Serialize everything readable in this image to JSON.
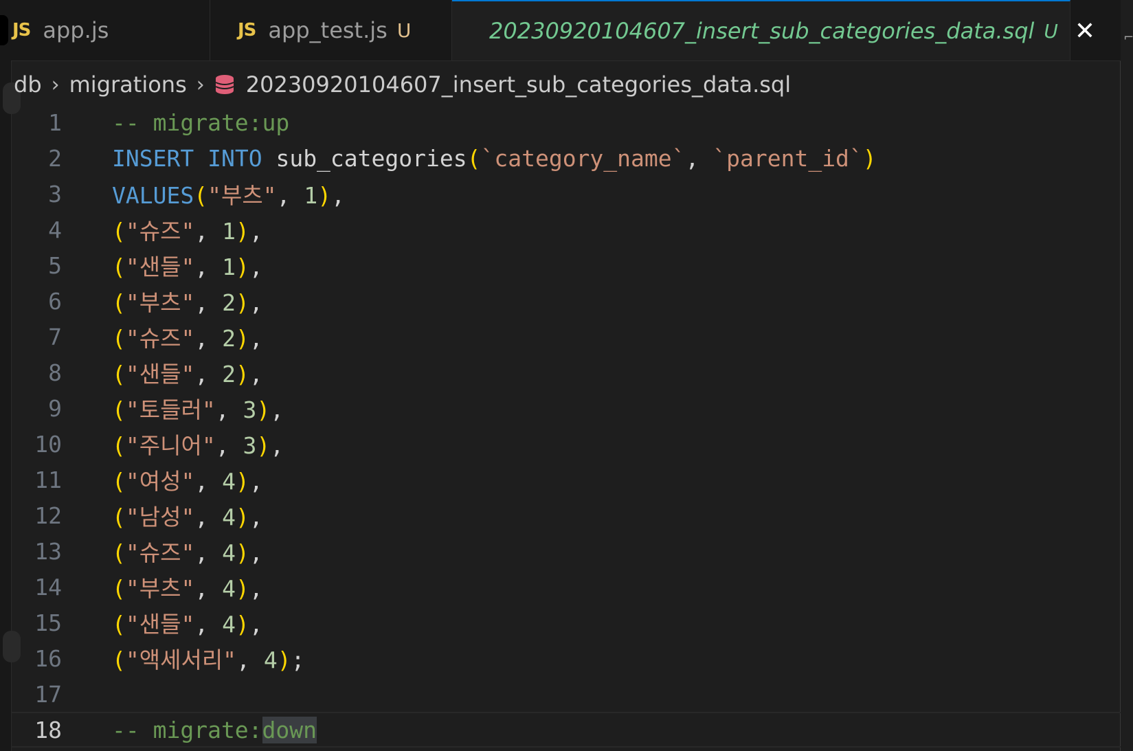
{
  "tabs": [
    {
      "icon": "JS",
      "label": "app.js",
      "status": ""
    },
    {
      "icon": "JS",
      "label": "app_test.js",
      "status": "U"
    },
    {
      "icon": "database-icon",
      "label": "20230920104607_insert_sub_categories_data.sql",
      "status": "U",
      "close": "✕"
    }
  ],
  "breadcrumb": {
    "items": [
      "db",
      "migrations",
      "20230920104607_insert_sub_categories_data.sql"
    ],
    "separator": "›"
  },
  "colors": {
    "comment": "#6a9955",
    "keyword": "#569cd6",
    "string": "#ce9178",
    "number": "#b5cea8",
    "bracket": "#ffd700",
    "modified": "#73c991"
  },
  "editor": {
    "line_numbers": [
      "1",
      "2",
      "3",
      "4",
      "5",
      "6",
      "7",
      "8",
      "9",
      "10",
      "11",
      "12",
      "13",
      "14",
      "15",
      "16",
      "17",
      "18"
    ],
    "l1": "-- migrate:up",
    "l2": {
      "kw1": "INSERT",
      "kw2": "INTO",
      "table": "sub_categories",
      "col1": "`category_name`",
      "col2": "`parent_id`"
    },
    "l3": {
      "kw": "VALUES",
      "name": "\"부츠\"",
      "num": "1"
    },
    "rows": [
      {
        "name": "\"슈즈\"",
        "num": "1"
      },
      {
        "name": "\"샌들\"",
        "num": "1"
      },
      {
        "name": "\"부츠\"",
        "num": "2"
      },
      {
        "name": "\"슈즈\"",
        "num": "2"
      },
      {
        "name": "\"샌들\"",
        "num": "2"
      },
      {
        "name": "\"토들러\"",
        "num": "3"
      },
      {
        "name": "\"주니어\"",
        "num": "3"
      },
      {
        "name": "\"여성\"",
        "num": "4"
      },
      {
        "name": "\"남성\"",
        "num": "4"
      },
      {
        "name": "\"슈즈\"",
        "num": "4"
      },
      {
        "name": "\"부츠\"",
        "num": "4"
      },
      {
        "name": "\"샌들\"",
        "num": "4"
      }
    ],
    "l16": {
      "name": "\"액세서리\"",
      "num": "4"
    },
    "l18": {
      "prefix": "-- migrate:",
      "hl": "down"
    }
  }
}
